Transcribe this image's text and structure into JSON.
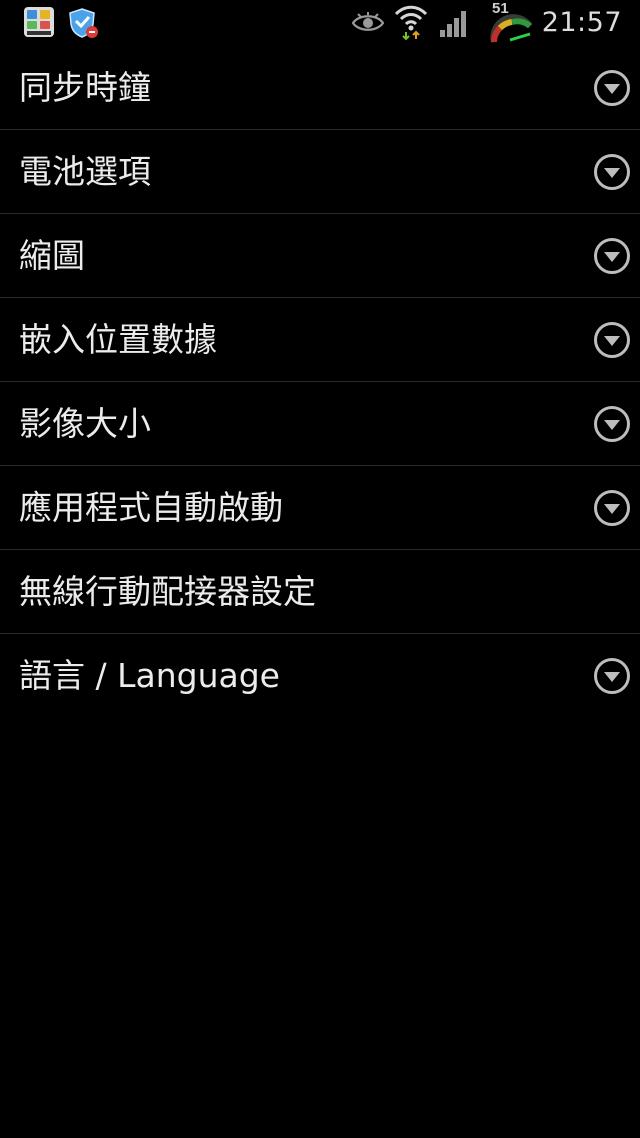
{
  "status_bar": {
    "time": "21:57",
    "speed_value": "51",
    "icons": [
      "nikon-app-icon",
      "shield-alert-icon",
      "eye-icon",
      "wifi-icon",
      "signal-icon",
      "speedometer-icon"
    ]
  },
  "settings": {
    "items": [
      {
        "label": "同步時鐘",
        "expandable": true,
        "icon": "chevron-down-circle-icon"
      },
      {
        "label": "電池選項",
        "expandable": true,
        "icon": "chevron-down-circle-icon"
      },
      {
        "label": "縮圖",
        "expandable": true,
        "icon": "chevron-down-circle-icon"
      },
      {
        "label": "嵌入位置數據",
        "expandable": true,
        "icon": "chevron-down-circle-icon"
      },
      {
        "label": "影像大小",
        "expandable": true,
        "icon": "chevron-down-circle-icon"
      },
      {
        "label": "應用程式自動啟動",
        "expandable": true,
        "icon": "chevron-down-circle-icon"
      },
      {
        "label": "無線行動配接器設定",
        "expandable": false
      },
      {
        "label": "語言 / Language",
        "expandable": true,
        "icon": "chevron-down-circle-icon"
      }
    ]
  }
}
